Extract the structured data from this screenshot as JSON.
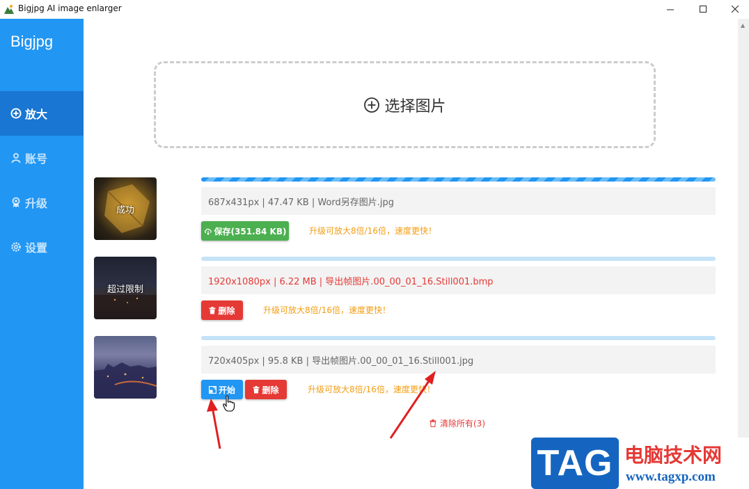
{
  "window": {
    "title": "Bigjpg AI image enlarger",
    "minimize": "—",
    "maximize": "☐",
    "close": "✕"
  },
  "sidebar": {
    "brand": "Bigjpg",
    "items": [
      {
        "label": "放大",
        "icon": "plus-circle-icon",
        "active": true
      },
      {
        "label": "账号",
        "icon": "user-icon",
        "active": false
      },
      {
        "label": "升级",
        "icon": "award-icon",
        "active": false
      },
      {
        "label": "设置",
        "icon": "gear-icon",
        "active": false
      }
    ]
  },
  "dropzone": {
    "label": "选择图片",
    "icon": "plus-circle-icon"
  },
  "files": [
    {
      "thumb_label": "成功",
      "info": "687x431px | 47.47 KB | Word另存图片.jpg",
      "progress": 1.0,
      "button": "保存(351.84 KB)",
      "upgrade_tip": "升级可放大8倍/16倍，速度更快！"
    },
    {
      "thumb_label": "超过限制",
      "info": "1920x1080px | 6.22 MB | 导出帧图片.00_00_01_16.Still001.bmp",
      "progress": 0.0,
      "button": "删除",
      "upgrade_tip": "升级可放大8倍/16倍，速度更快！"
    },
    {
      "thumb_label": "",
      "info": "720x405px | 95.8 KB | 导出帧图片.00_00_01_16.Still001.jpg",
      "progress": 0.0,
      "start_button": "开始",
      "button": "删除",
      "upgrade_tip": "升级可放大8倍/16倍，速度更快！"
    }
  ],
  "clear_all": "清除所有(3)",
  "watermark": {
    "tag": "TAG",
    "site": "电脑技术网",
    "url": "www.tagxp.com"
  },
  "colors": {
    "sidebar": "#2196f3",
    "sidebar_active": "#1976d2",
    "success": "#4caf50",
    "danger": "#e53935",
    "primary": "#2196f3",
    "warning": "#f39c12"
  }
}
